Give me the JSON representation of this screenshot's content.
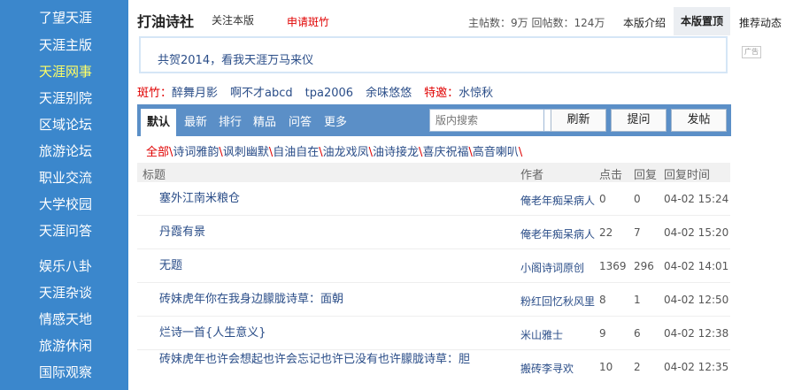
{
  "sidebar": {
    "items": [
      {
        "label": "了望天涯",
        "active": false
      },
      {
        "label": "天涯主版",
        "active": false
      },
      {
        "label": "天涯网事",
        "active": true
      },
      {
        "label": "天涯别院",
        "active": false
      },
      {
        "label": "区域论坛",
        "active": false
      },
      {
        "label": "旅游论坛",
        "active": false
      },
      {
        "label": "职业交流",
        "active": false
      },
      {
        "label": "大学校园",
        "active": false
      },
      {
        "label": "天涯问答",
        "active": false
      },
      {
        "label": "娱乐八卦",
        "active": false
      },
      {
        "label": "天涯杂谈",
        "active": false
      },
      {
        "label": "情感天地",
        "active": false
      },
      {
        "label": "旅游休闲",
        "active": false
      },
      {
        "label": "国际观察",
        "active": false
      }
    ]
  },
  "header": {
    "title": "打油诗社",
    "follow": "关注本版",
    "apply": "申请斑竹",
    "stats": "主帖数：9万 回帖数：124万",
    "intro": "本版介绍",
    "top": "本版置顶",
    "recommend": "推荐动态"
  },
  "notice": {
    "text": "共贺2014，看我天涯万马来仪",
    "ad": "广告"
  },
  "moderators": {
    "label": "斑竹：",
    "names": [
      "醉舞月影",
      "啊不才abcd",
      "tpa2006",
      "余味悠悠"
    ],
    "guest_label": "特邀：",
    "guest": "水惊秋"
  },
  "toolbar": {
    "tabs": [
      "默认",
      "最新",
      "排行",
      "精品",
      "问答",
      "更多"
    ],
    "search_placeholder": "版内搜索",
    "refresh": "刷新",
    "ask": "提问",
    "post": "发帖"
  },
  "categories": [
    "全部",
    "诗词雅韵",
    "讽刺幽默",
    "自油自在",
    "油龙戏凤",
    "油诗接龙",
    "喜庆祝福",
    "高音喇叭"
  ],
  "table": {
    "headers": {
      "title": "标题",
      "author": "作者",
      "clicks": "点击",
      "replies": "回复",
      "time": "回复时间"
    },
    "rows": [
      {
        "title": "塞外江南米粮仓",
        "author": "俺老年痴呆病人",
        "clicks": "0",
        "replies": "0",
        "time": "04-02 15:24"
      },
      {
        "title": "丹霞有景",
        "author": "俺老年痴呆病人",
        "clicks": "22",
        "replies": "7",
        "time": "04-02 15:20"
      },
      {
        "title": "无题",
        "author": "小阁诗词原创",
        "clicks": "1369",
        "replies": "296",
        "time": "04-02 14:01"
      },
      {
        "title": "砖妹虎年你在我身边朦胧诗草：面朝",
        "author": "粉红回忆秋风里",
        "clicks": "8",
        "replies": "1",
        "time": "04-02 12:50"
      },
      {
        "title": "烂诗一首{人生意义}",
        "author": "米山雅士",
        "clicks": "9",
        "replies": "6",
        "time": "04-02 12:38"
      },
      {
        "title": "砖妹虎年也许会想起也许会忘记也许已没有也许朦胧诗草：胆",
        "author": "搬砖李寻欢",
        "clicks": "10",
        "replies": "2",
        "time": "04-02 12:35"
      }
    ]
  }
}
